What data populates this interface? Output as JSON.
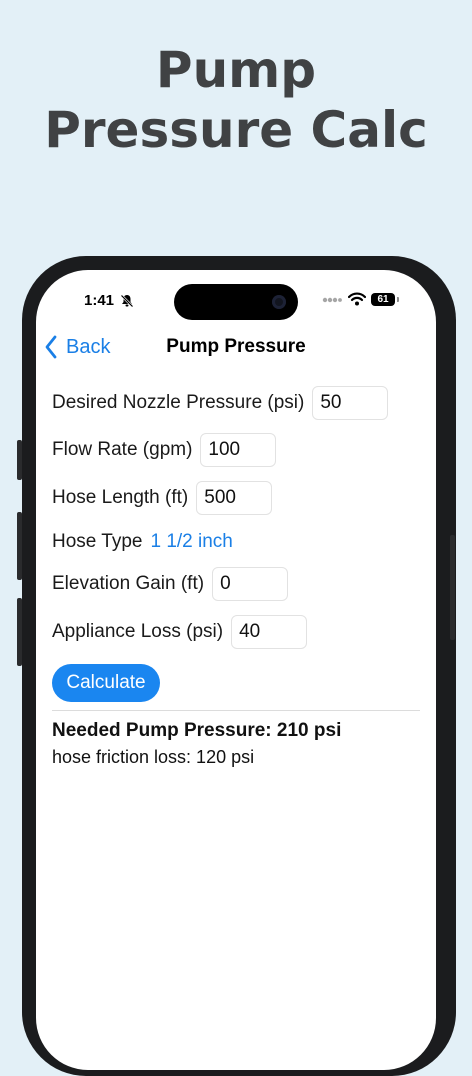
{
  "promo": {
    "title_line1": "Pump",
    "title_line2": "Pressure Calc"
  },
  "status_bar": {
    "time": "1:41",
    "battery": "61"
  },
  "nav": {
    "back_label": "Back",
    "title": "Pump Pressure"
  },
  "form": {
    "nozzle": {
      "label": "Desired Nozzle Pressure (psi)",
      "value": "50"
    },
    "flow": {
      "label": "Flow Rate (gpm)",
      "value": "100"
    },
    "hose_length": {
      "label": "Hose Length (ft)",
      "value": "500"
    },
    "hose_type": {
      "label": "Hose Type",
      "value": "1 1/2 inch"
    },
    "elevation": {
      "label": "Elevation Gain (ft)",
      "value": "0"
    },
    "appliance": {
      "label": "Appliance Loss (psi)",
      "value": "40"
    }
  },
  "calculate_label": "Calculate",
  "result": {
    "main": "Needed Pump Pressure: 210 psi",
    "sub": "hose friction loss: 120 psi"
  },
  "colors": {
    "accent": "#1a86f0",
    "link": "#1a7fe6",
    "background": "#e3f0f7"
  },
  "icons": [
    "bell-slash-icon",
    "cellular-signal-icon",
    "wifi-icon",
    "battery-icon",
    "chevron-left-icon"
  ]
}
